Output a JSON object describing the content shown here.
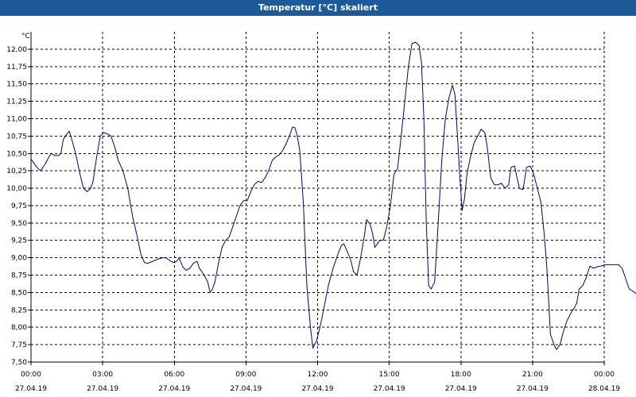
{
  "window": {
    "title": "Temperatur [°C] skaliert"
  },
  "chart_data": {
    "type": "line",
    "title": "Temperatur [°C] skaliert",
    "ylabel": "°C",
    "xlabel": "",
    "ylim": [
      7.5,
      12.25
    ],
    "xlim_hours": [
      0,
      24
    ],
    "grid": true,
    "y_ticks": [
      "7,50",
      "7,75",
      "8,00",
      "8,25",
      "8,50",
      "8,75",
      "9,00",
      "9,25",
      "9,50",
      "9,75",
      "10,00",
      "10,25",
      "10,50",
      "10,75",
      "11,00",
      "11,25",
      "11,50",
      "11,75",
      "12,00"
    ],
    "x_ticks": [
      {
        "time": "00:00",
        "date": "27.04.19"
      },
      {
        "time": "03:00",
        "date": "27.04.19"
      },
      {
        "time": "06:00",
        "date": "27.04.19"
      },
      {
        "time": "09:00",
        "date": "27.04.19"
      },
      {
        "time": "12:00",
        "date": "27.04.19"
      },
      {
        "time": "15:00",
        "date": "27.04.19"
      },
      {
        "time": "18:00",
        "date": "27.04.19"
      },
      {
        "time": "21:00",
        "date": "27.04.19"
      },
      {
        "time": "00:00",
        "date": "28.04.19"
      }
    ],
    "colors": {
      "line": "#00008b",
      "grid": "#000000",
      "title_bar": "#1c5a9a"
    },
    "series": [
      {
        "points": [
          [
            0.0,
            10.42
          ],
          [
            0.25,
            10.3
          ],
          [
            0.4,
            10.25
          ],
          [
            0.6,
            10.35
          ],
          [
            0.75,
            10.45
          ],
          [
            0.85,
            10.5
          ],
          [
            1.0,
            10.47
          ],
          [
            1.15,
            10.47
          ],
          [
            1.25,
            10.5
          ],
          [
            1.35,
            10.7
          ],
          [
            1.5,
            10.78
          ],
          [
            1.6,
            10.82
          ],
          [
            1.75,
            10.65
          ],
          [
            1.9,
            10.45
          ],
          [
            2.05,
            10.2
          ],
          [
            2.2,
            10.0
          ],
          [
            2.35,
            9.95
          ],
          [
            2.5,
            10.0
          ],
          [
            2.6,
            10.1
          ],
          [
            2.75,
            10.45
          ],
          [
            2.9,
            10.75
          ],
          [
            3.05,
            10.8
          ],
          [
            3.2,
            10.78
          ],
          [
            3.35,
            10.75
          ],
          [
            3.5,
            10.6
          ],
          [
            3.65,
            10.4
          ],
          [
            3.85,
            10.25
          ],
          [
            4.05,
            10.0
          ],
          [
            4.25,
            9.6
          ],
          [
            4.45,
            9.3
          ],
          [
            4.6,
            9.05
          ],
          [
            4.75,
            8.93
          ],
          [
            4.9,
            8.92
          ],
          [
            5.1,
            8.95
          ],
          [
            5.3,
            8.98
          ],
          [
            5.5,
            9.0
          ],
          [
            5.65,
            9.0
          ],
          [
            5.85,
            8.95
          ],
          [
            6.0,
            8.93
          ],
          [
            6.1,
            8.95
          ],
          [
            6.2,
            9.0
          ],
          [
            6.35,
            8.87
          ],
          [
            6.5,
            8.82
          ],
          [
            6.65,
            8.85
          ],
          [
            6.8,
            8.92
          ],
          [
            6.95,
            8.95
          ],
          [
            7.05,
            8.85
          ],
          [
            7.25,
            8.75
          ],
          [
            7.4,
            8.65
          ],
          [
            7.5,
            8.5
          ],
          [
            7.6,
            8.55
          ],
          [
            7.7,
            8.65
          ],
          [
            7.85,
            8.92
          ],
          [
            8.0,
            9.15
          ],
          [
            8.15,
            9.25
          ],
          [
            8.3,
            9.3
          ],
          [
            8.45,
            9.45
          ],
          [
            8.6,
            9.6
          ],
          [
            8.75,
            9.75
          ],
          [
            8.9,
            9.82
          ],
          [
            9.05,
            9.82
          ],
          [
            9.2,
            9.95
          ],
          [
            9.35,
            10.05
          ],
          [
            9.5,
            10.1
          ],
          [
            9.65,
            10.08
          ],
          [
            9.8,
            10.15
          ],
          [
            9.95,
            10.25
          ],
          [
            10.1,
            10.4
          ],
          [
            10.25,
            10.45
          ],
          [
            10.4,
            10.48
          ],
          [
            10.55,
            10.55
          ],
          [
            10.7,
            10.65
          ],
          [
            10.85,
            10.78
          ],
          [
            10.95,
            10.88
          ],
          [
            11.05,
            10.87
          ],
          [
            11.15,
            10.75
          ],
          [
            11.25,
            10.55
          ],
          [
            11.4,
            9.8
          ],
          [
            11.55,
            8.6
          ],
          [
            11.7,
            8.0
          ],
          [
            11.8,
            7.7
          ],
          [
            11.95,
            7.8
          ],
          [
            12.1,
            8.0
          ],
          [
            12.25,
            8.25
          ],
          [
            12.45,
            8.6
          ],
          [
            12.65,
            8.85
          ],
          [
            12.85,
            9.05
          ],
          [
            13.0,
            9.18
          ],
          [
            13.1,
            9.2
          ],
          [
            13.25,
            9.08
          ],
          [
            13.4,
            8.95
          ],
          [
            13.5,
            8.8
          ],
          [
            13.65,
            8.75
          ],
          [
            13.8,
            9.0
          ],
          [
            13.95,
            9.3
          ],
          [
            14.05,
            9.55
          ],
          [
            14.2,
            9.48
          ],
          [
            14.3,
            9.35
          ],
          [
            14.4,
            9.15
          ],
          [
            14.5,
            9.2
          ],
          [
            14.6,
            9.25
          ],
          [
            14.75,
            9.25
          ],
          [
            14.9,
            9.45
          ],
          [
            15.05,
            9.75
          ],
          [
            15.2,
            10.2
          ],
          [
            15.35,
            10.28
          ],
          [
            15.5,
            10.75
          ],
          [
            15.65,
            11.25
          ],
          [
            15.8,
            11.75
          ],
          [
            15.95,
            12.08
          ],
          [
            16.1,
            12.1
          ],
          [
            16.25,
            12.05
          ],
          [
            16.35,
            11.8
          ],
          [
            16.45,
            11.0
          ],
          [
            16.55,
            9.5
          ],
          [
            16.65,
            8.6
          ],
          [
            16.75,
            8.55
          ],
          [
            16.9,
            8.65
          ],
          [
            17.05,
            9.5
          ],
          [
            17.2,
            10.4
          ],
          [
            17.35,
            11.0
          ],
          [
            17.5,
            11.3
          ],
          [
            17.65,
            11.48
          ],
          [
            17.75,
            11.35
          ],
          [
            17.85,
            10.8
          ],
          [
            17.95,
            10.2
          ],
          [
            18.05,
            9.68
          ],
          [
            18.15,
            9.85
          ],
          [
            18.25,
            10.2
          ],
          [
            18.4,
            10.45
          ],
          [
            18.55,
            10.65
          ],
          [
            18.7,
            10.75
          ],
          [
            18.85,
            10.85
          ],
          [
            19.0,
            10.8
          ],
          [
            19.1,
            10.6
          ],
          [
            19.25,
            10.15
          ],
          [
            19.4,
            10.05
          ],
          [
            19.55,
            10.05
          ],
          [
            19.7,
            10.07
          ],
          [
            19.85,
            10.0
          ],
          [
            20.0,
            10.05
          ],
          [
            20.1,
            10.3
          ],
          [
            20.25,
            10.32
          ],
          [
            20.35,
            10.15
          ],
          [
            20.45,
            10.0
          ],
          [
            20.6,
            9.98
          ],
          [
            20.75,
            10.3
          ],
          [
            20.9,
            10.32
          ],
          [
            21.05,
            10.2
          ],
          [
            21.2,
            10.0
          ],
          [
            21.35,
            9.8
          ],
          [
            21.5,
            9.3
          ],
          [
            21.6,
            8.85
          ],
          [
            21.75,
            7.9
          ],
          [
            21.9,
            7.75
          ],
          [
            22.0,
            7.68
          ],
          [
            22.15,
            7.75
          ],
          [
            22.3,
            7.95
          ],
          [
            22.45,
            8.1
          ],
          [
            22.6,
            8.2
          ],
          [
            22.75,
            8.28
          ],
          [
            22.85,
            8.35
          ],
          [
            22.95,
            8.55
          ],
          [
            23.1,
            8.6
          ],
          [
            23.25,
            8.72
          ],
          [
            23.4,
            8.88
          ],
          [
            23.55,
            8.85
          ],
          [
            23.7,
            8.87
          ],
          [
            23.85,
            8.88
          ],
          [
            24.05,
            8.9
          ],
          [
            24.25,
            8.9
          ],
          [
            24.45,
            8.9
          ],
          [
            24.6,
            8.9
          ],
          [
            24.75,
            8.85
          ],
          [
            24.9,
            8.7
          ],
          [
            25.05,
            8.55
          ],
          [
            25.2,
            8.52
          ],
          [
            25.35,
            8.48
          ],
          [
            25.5,
            8.45
          ],
          [
            25.6,
            8.48
          ],
          [
            25.75,
            8.57
          ],
          [
            25.9,
            8.5
          ],
          [
            26.05,
            8.48
          ],
          [
            26.2,
            8.35
          ],
          [
            26.35,
            8.38
          ]
        ]
      }
    ]
  }
}
